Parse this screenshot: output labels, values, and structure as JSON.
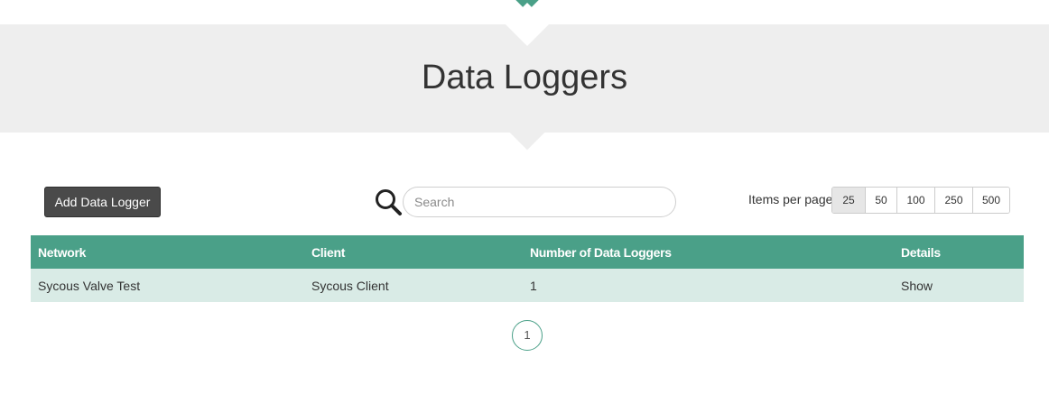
{
  "header": {
    "title": "Data Loggers",
    "accent_color": "#4aa088",
    "banner_color": "#eeeeee"
  },
  "toolbar": {
    "add_label": "Add Data Logger",
    "search_icon": "search-icon",
    "search_placeholder": "Search",
    "search_value": "",
    "items_per_page_label": "Items per page",
    "items_per_page_options": [
      "25",
      "50",
      "100",
      "250",
      "500"
    ],
    "items_per_page_selected": "25"
  },
  "table": {
    "columns": [
      "Network",
      "Client",
      "Number of Data Loggers",
      "Details"
    ],
    "rows": [
      [
        "Sycous Valve Test",
        "Sycous Client",
        "1",
        "Show"
      ]
    ]
  },
  "pagination": {
    "current_page": "1"
  }
}
